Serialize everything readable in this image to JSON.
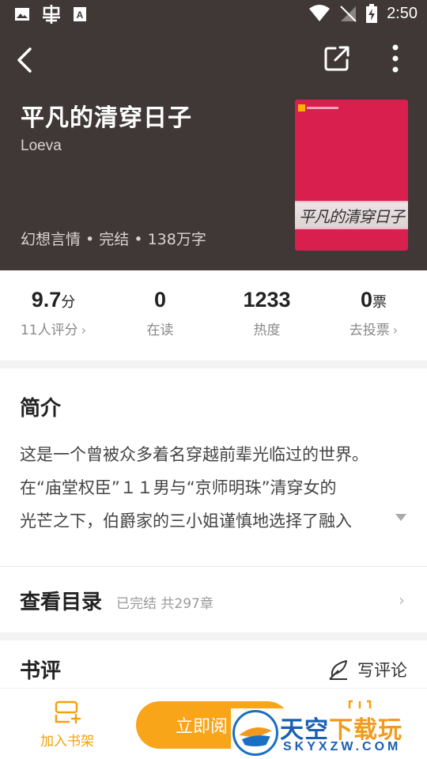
{
  "status_bar": {
    "time": "2:50",
    "left_icons": [
      "image-icon",
      "bug-icon",
      "font-download-icon"
    ],
    "right_icons": [
      "wifi-icon",
      "no-signal-icon",
      "battery-charging-icon"
    ]
  },
  "header": {
    "back_icon": "back-icon",
    "share_icon": "share-icon",
    "more_icon": "more-vertical-icon"
  },
  "book": {
    "title": "平凡的清穿日子",
    "author": "Loeva",
    "meta": "幻想言情 • 完结 • 138万字",
    "cover_title": "平凡的清穿日子",
    "cover_color": "#d81f4d"
  },
  "stats": [
    {
      "value": "9.7",
      "unit": "分",
      "label": "11人评分",
      "chevron": "›"
    },
    {
      "value": "0",
      "unit": "",
      "label": "在读",
      "chevron": ""
    },
    {
      "value": "1233",
      "unit": "",
      "label": "热度",
      "chevron": ""
    },
    {
      "value": "0",
      "unit": "票",
      "label": "去投票",
      "chevron": "›"
    }
  ],
  "intro": {
    "heading": "简介",
    "lines": [
      "这是一个曾被众多着名穿越前辈光临过的世界。",
      "在“庙堂权臣”１１男与“京师明珠”清穿女的",
      "光芒之下，伯爵家的三小姐谨慎地选择了融入"
    ]
  },
  "toc": {
    "title": "查看目录",
    "sub": "已完结 共297章",
    "arrow": "›"
  },
  "reviews": {
    "title": "书评",
    "write_label": "写评论"
  },
  "bottom": {
    "shelf_label": "加入书架",
    "read_label": "立即阅",
    "accent": "#f8a51a"
  },
  "watermark": {
    "brand": "天空",
    "brand_suffix": "下载玩",
    "domain": "SKYXZW.COM"
  }
}
